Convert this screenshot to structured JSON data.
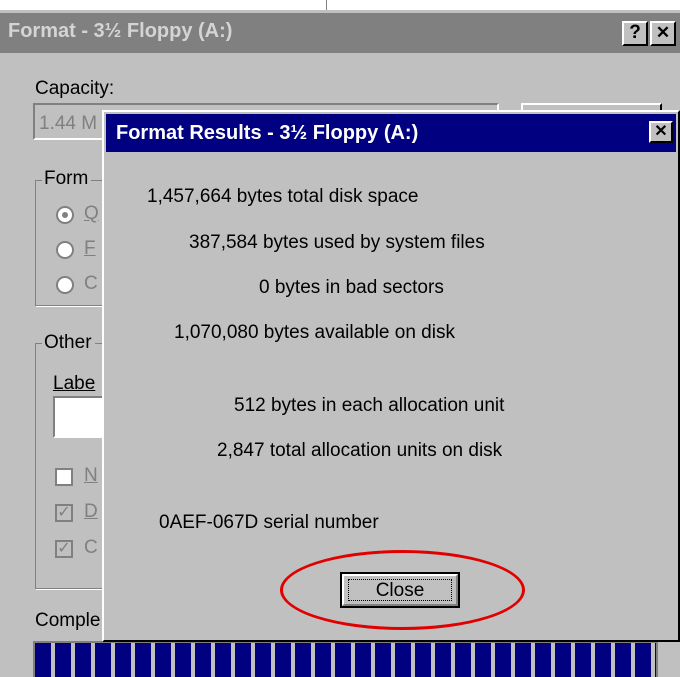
{
  "format_dialog": {
    "title": "Format - 3½ Floppy (A:)",
    "help_button": "?",
    "close_button": "✕",
    "capacity_label": "Capacity:",
    "capacity_value": "1.44 M",
    "format_type_group": "Form",
    "radio_labels": [
      "Q",
      "F",
      "C"
    ],
    "other_group": "Other",
    "label_label": "Labe",
    "check_labels": [
      "N",
      "D",
      "C"
    ],
    "check_glyph": "✓",
    "complete_label": "Comple",
    "progress_percent": 100
  },
  "results_dialog": {
    "title": "Format Results - 3½ Floppy (A:)",
    "close_icon": "✕",
    "lines": {
      "total_space": "1,457,664 bytes total disk space",
      "system_files": "387,584 bytes used by system files",
      "bad_sectors": "0 bytes in bad sectors",
      "available": "1,070,080 bytes available on disk",
      "allocation_unit": "512 bytes in each allocation unit",
      "total_units": "2,847 total allocation units on disk",
      "serial": "0AEF-067D serial number"
    },
    "close_button": "Close"
  },
  "colors": {
    "title_active": "#000080",
    "title_inactive": "#808080",
    "dialog_face": "#c0c0c0",
    "highlight": "#e00000"
  }
}
